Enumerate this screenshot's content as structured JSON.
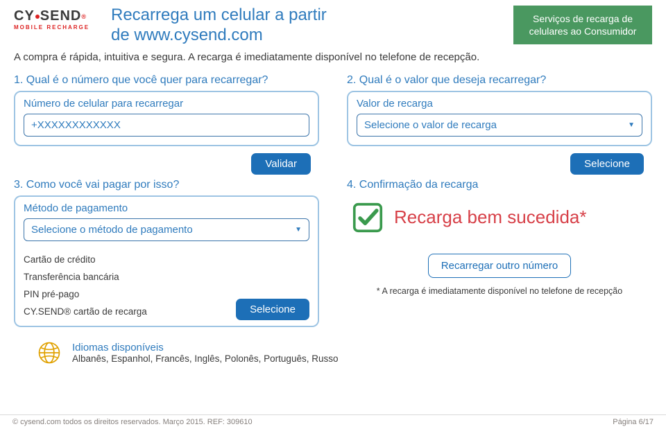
{
  "logo": {
    "main1": "CY",
    "main2": "SEND",
    "sub": "MOBILE RECHARGE"
  },
  "header_title_line1": "Recarrega um celular a partir",
  "header_title_line2": "de www.cysend.com",
  "top_badge_line1": "Serviços de recarga de",
  "top_badge_line2": "celulares ao Consumidor",
  "intro": "A compra é rápida, intuitiva e segura. A recarga é imediatamente disponível no telefone de recepção.",
  "step1": {
    "q": "1. Qual é o número que você quer para recarregar?",
    "label": "Número de celular para recarregar",
    "placeholder": "+XXXXXXXXXXXX",
    "button": "Validar"
  },
  "step2": {
    "q": "2. Qual é o valor que deseja recarregar?",
    "label": "Valor de recarga",
    "placeholder": "Selecione o valor de recarga",
    "button": "Selecione"
  },
  "step3": {
    "q": "3. Como você vai pagar por isso?",
    "label": "Método de pagamento",
    "placeholder": "Selecione o método de pagamento",
    "options": [
      "Cartão de crédito",
      "Transferência bancária",
      "PIN pré-pago",
      "CY.SEND® cartão de recarga"
    ],
    "button": "Selecione"
  },
  "step4": {
    "q": "4. Confirmação da recarga",
    "success": "Recarga bem sucedida*",
    "again": "Recarregar outro número",
    "note": "* A recarga é imediatamente disponível no telefone de recepção"
  },
  "languages": {
    "title": "Idiomas disponíveis",
    "list": "Albanês, Espanhol, Francês, Inglês, Polonês, Português, Russo"
  },
  "footer": {
    "left": "© cysend.com todos os direitos reservados. Março 2015. REF: 309610",
    "right": "Página 6/17"
  }
}
